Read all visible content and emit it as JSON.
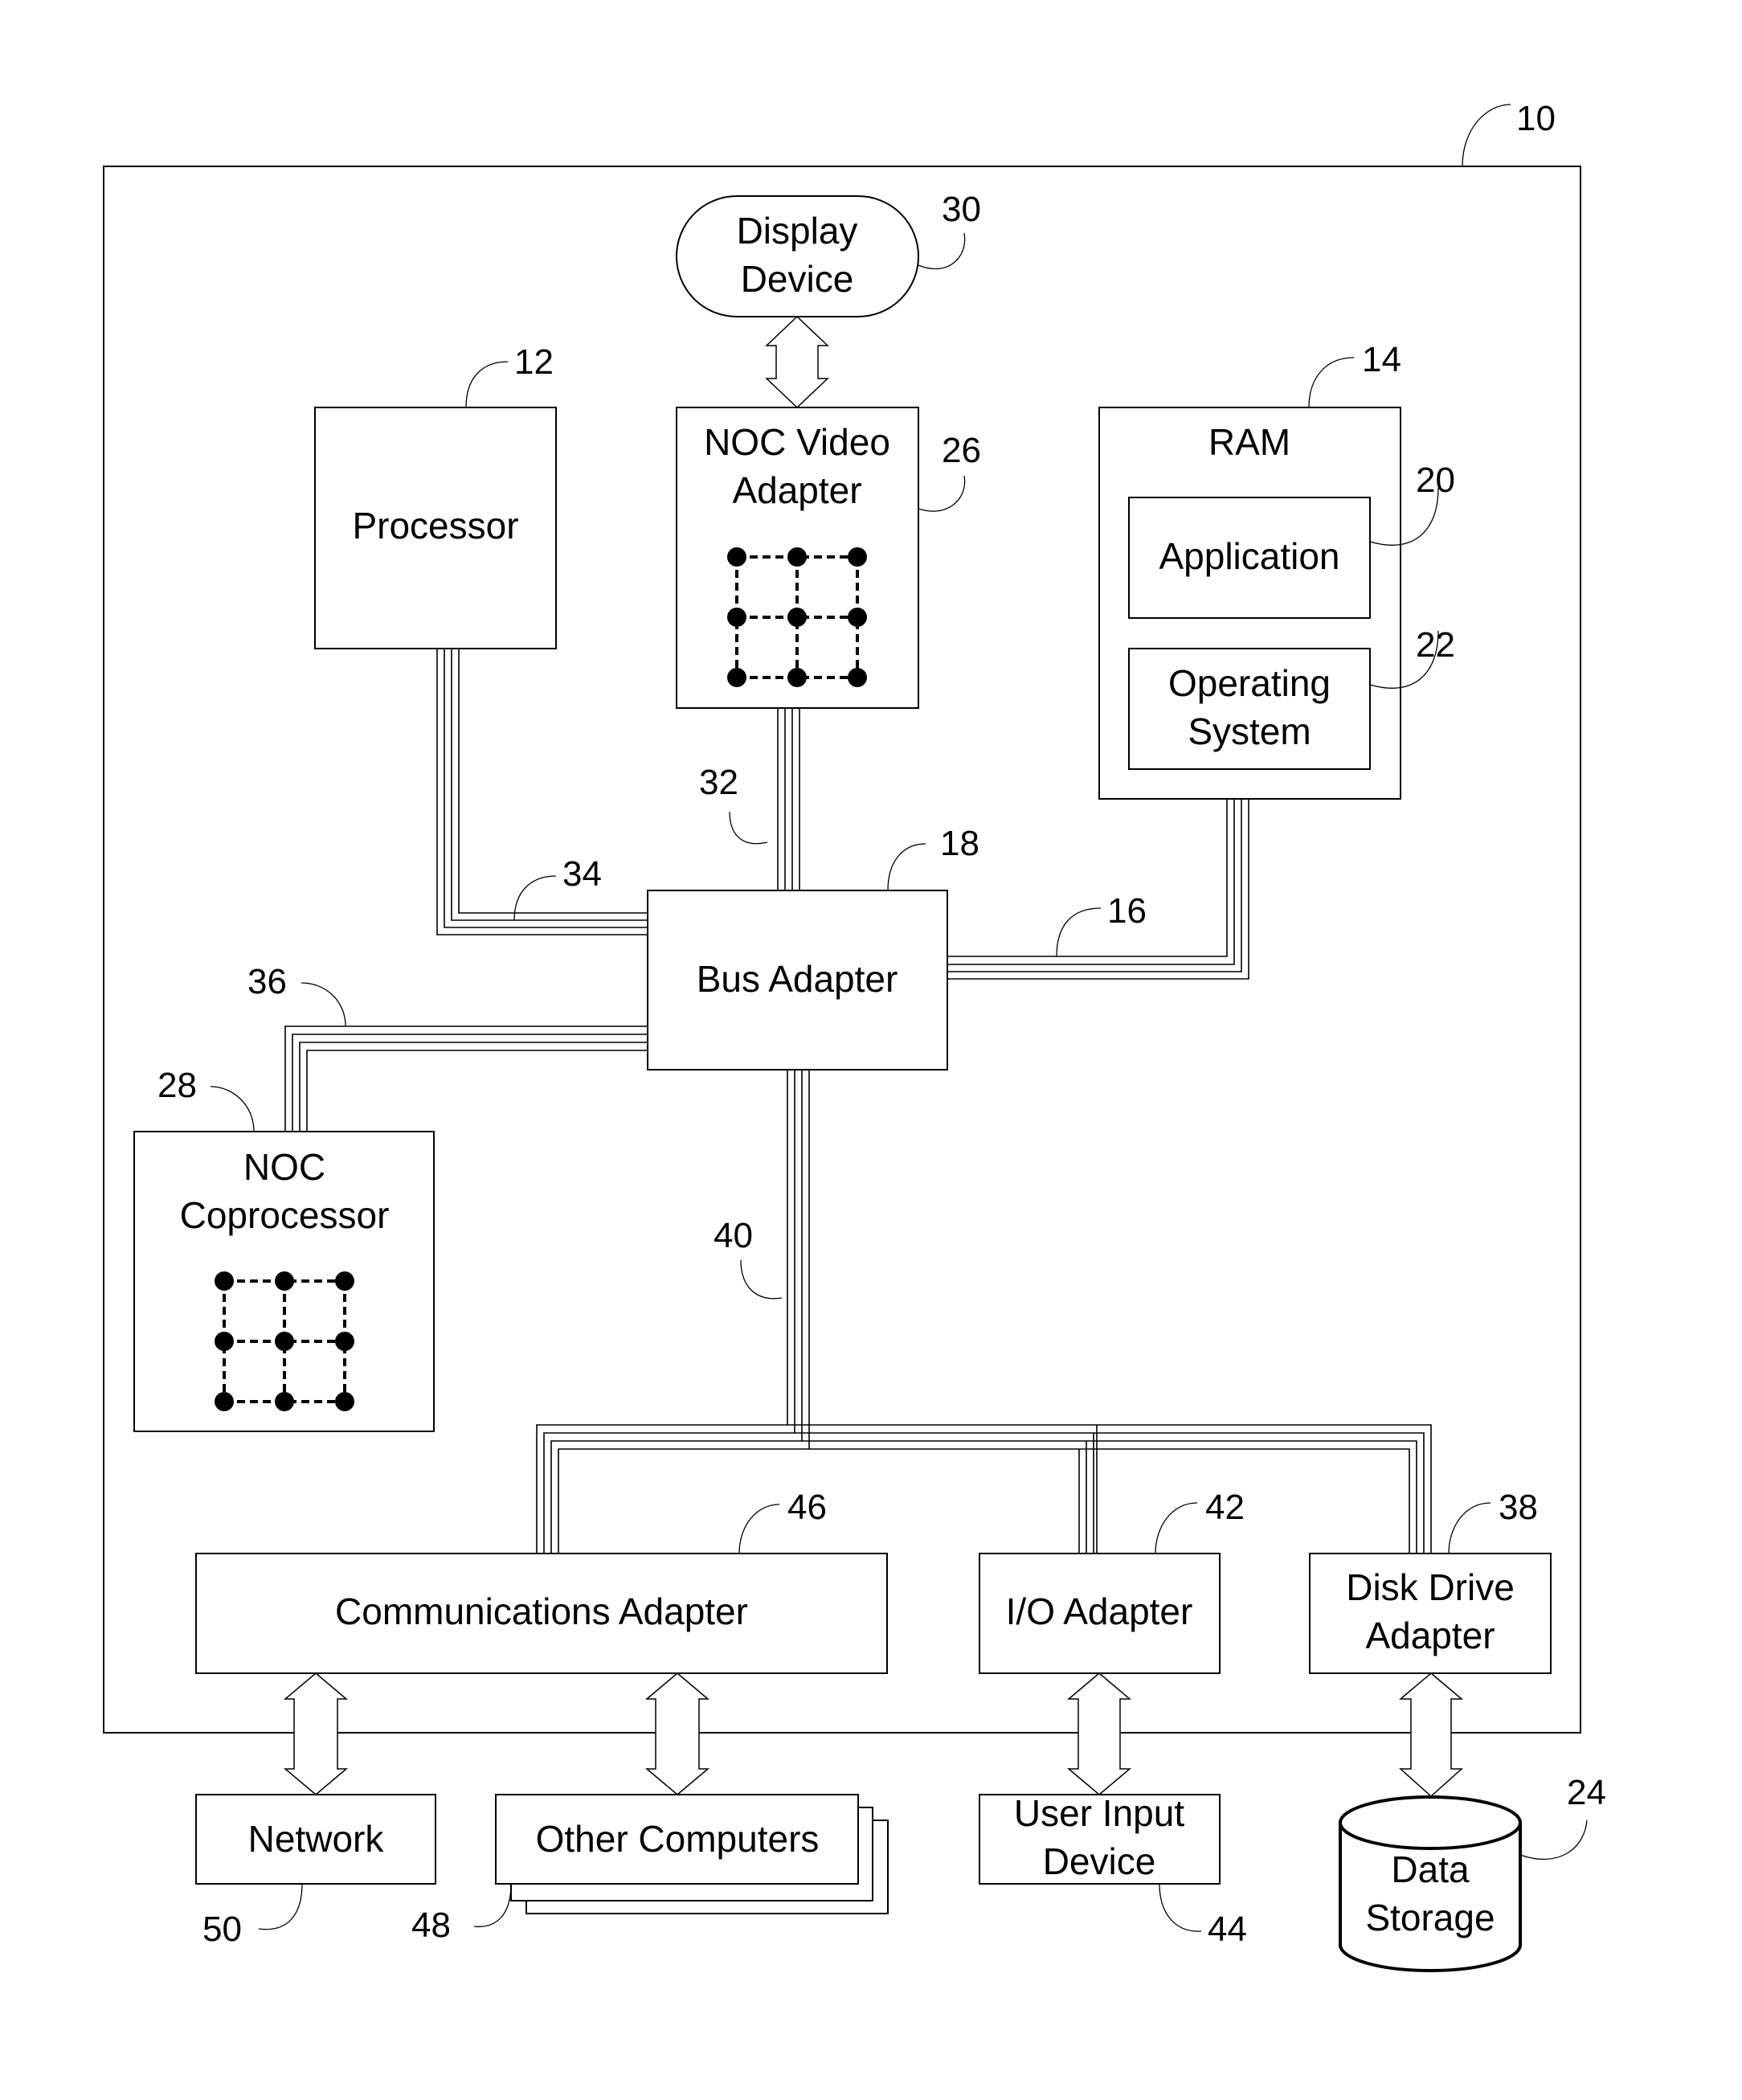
{
  "figure": {
    "system_ref": "10",
    "components": {
      "display_device": {
        "label_lines": [
          "Display",
          "Device"
        ],
        "ref": "30"
      },
      "processor": {
        "label_lines": [
          "Processor"
        ],
        "ref": "12"
      },
      "noc_video_adapter": {
        "label_lines": [
          "NOC Video",
          "Adapter"
        ],
        "ref": "26"
      },
      "ram": {
        "label_lines": [
          "RAM"
        ],
        "ref": "14"
      },
      "application": {
        "label_lines": [
          "Application"
        ],
        "ref": "20"
      },
      "operating_system": {
        "label_lines": [
          "Operating",
          "System"
        ],
        "ref": "22"
      },
      "bus_adapter": {
        "label_lines": [
          "Bus Adapter"
        ],
        "ref": "18"
      },
      "noc_coprocessor": {
        "label_lines": [
          "NOC",
          "Coprocessor"
        ],
        "ref": "28"
      },
      "communications_adapter": {
        "label_lines": [
          "Communications Adapter"
        ],
        "ref": "46"
      },
      "io_adapter": {
        "label_lines": [
          "I/O Adapter"
        ],
        "ref": "42"
      },
      "disk_drive_adapter": {
        "label_lines": [
          "Disk Drive",
          "Adapter"
        ],
        "ref": "38"
      },
      "network": {
        "label_lines": [
          "Network"
        ],
        "ref": "50"
      },
      "other_computers": {
        "label_lines": [
          "Other Computers"
        ],
        "ref": "48"
      },
      "user_input_device": {
        "label_lines": [
          "User Input",
          "Device"
        ],
        "ref": "44"
      },
      "data_storage": {
        "label_lines": [
          "Data",
          "Storage"
        ],
        "ref": "24"
      }
    },
    "buses": {
      "video_bus": {
        "ref": "32"
      },
      "front_side_bus": {
        "ref": "34"
      },
      "memory_bus": {
        "ref": "16"
      },
      "coprocessor_bus": {
        "ref": "36"
      },
      "expansion_bus": {
        "ref": "40"
      }
    }
  }
}
